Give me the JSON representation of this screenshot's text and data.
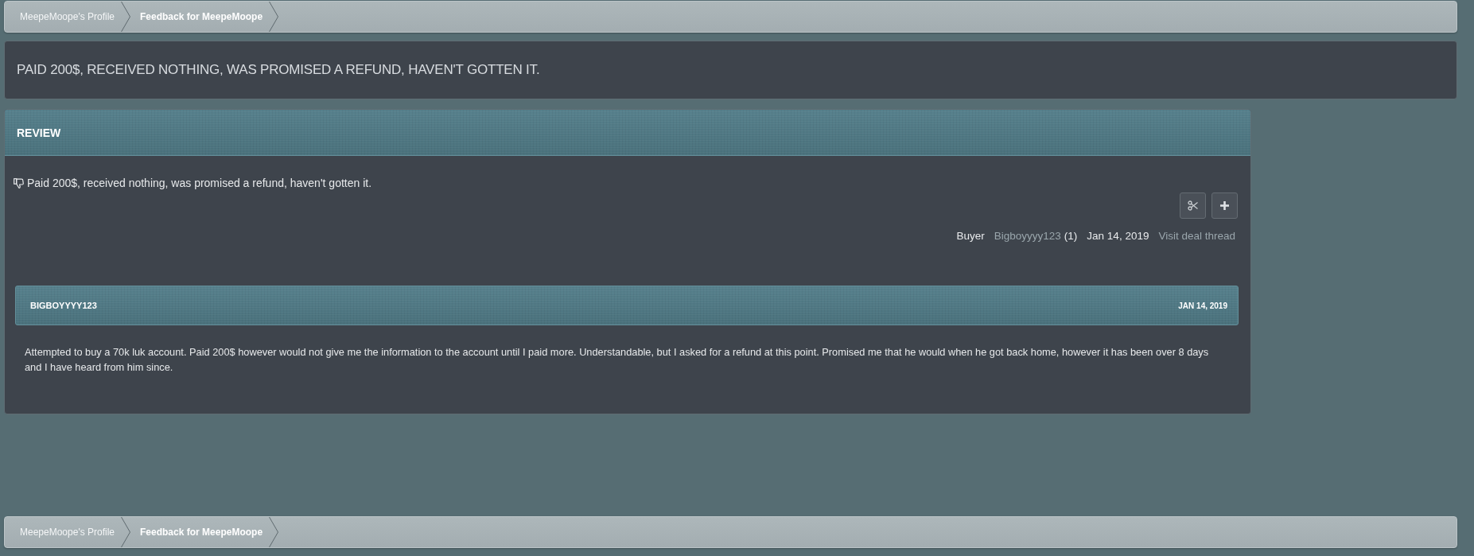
{
  "breadcrumbs_top": [
    {
      "label": "MeepeMoope's Profile",
      "selected": false
    },
    {
      "label": "Feedback for MeepeMoope",
      "selected": true
    }
  ],
  "title": "PAID 200$, RECEIVED NOTHING, WAS PROMISED A REFUND, HAVEN'T GOTTEN IT.",
  "review": {
    "heading": "REVIEW",
    "negative": true,
    "text": "Paid 200$, received nothing, was promised a refund, haven't gotten it.",
    "meta": {
      "role": "Buyer",
      "user": "Bigboyyyy123",
      "count": "(1)",
      "date": "Jan 14, 2019",
      "link": "Visit deal thread"
    }
  },
  "comment": {
    "author": "BIGBOYYYY123",
    "date": "JAN 14, 2019",
    "body": "Attempted to buy a 70k luk account. Paid 200$ however would not give me the information to the account until I paid more. Understandable, but I asked for a refund at this point. Promised me that he would when he got back home, however it has been over 8 days and I have heard from him since."
  },
  "breadcrumbs_bottom": [
    {
      "label": "MeepeMoope's Profile",
      "selected": false
    },
    {
      "label": "Feedback for MeepeMoope",
      "selected": true
    }
  ]
}
